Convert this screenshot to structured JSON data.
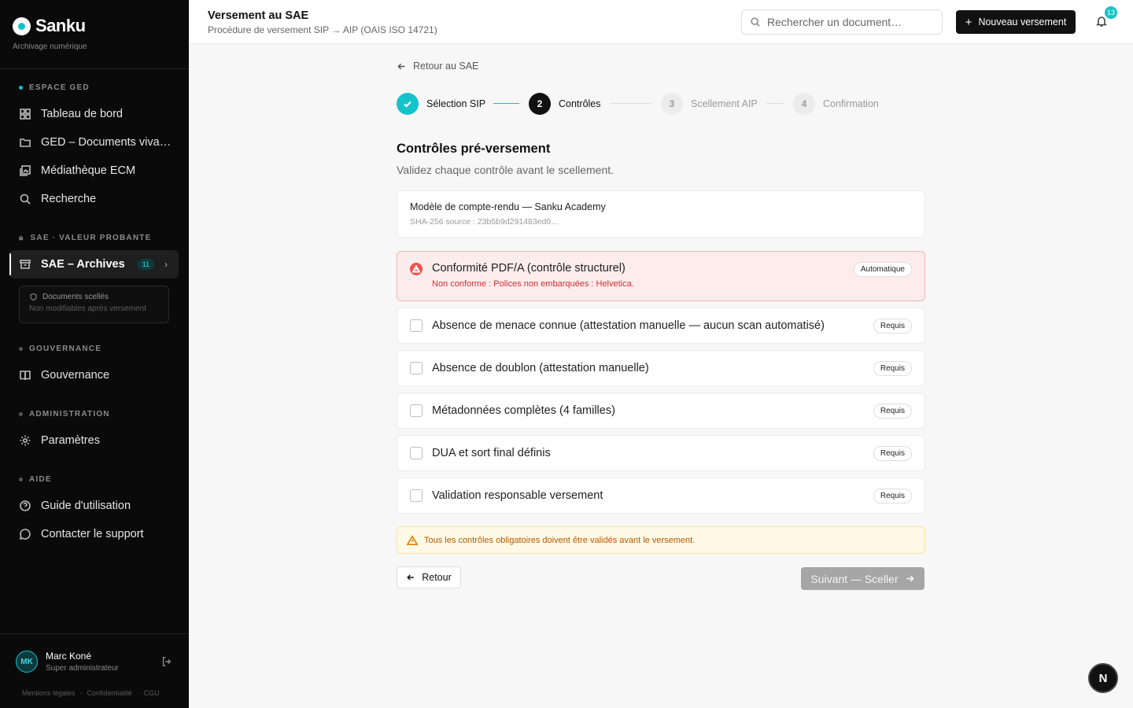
{
  "brand": {
    "name": "Sanku",
    "tagline": "Archivage numérique"
  },
  "sidebar": {
    "sections": [
      {
        "label": "ESPACE GED"
      },
      {
        "label": "SAE · VALEUR PROBANTE"
      },
      {
        "label": "GOUVERNANCE"
      },
      {
        "label": "ADMINISTRATION"
      },
      {
        "label": "AIDE"
      }
    ],
    "items": [
      {
        "label": "Tableau de bord",
        "icon": "dashboard-icon"
      },
      {
        "label": "GED – Documents viva…",
        "icon": "folder-icon"
      },
      {
        "label": "Médiathèque ECM",
        "icon": "media-icon"
      },
      {
        "label": "Recherche",
        "icon": "search-icon"
      },
      {
        "label": "SAE – Archives",
        "icon": "archive-icon",
        "badge": "11",
        "active": true
      },
      {
        "label": "Gouvernance",
        "icon": "book-icon"
      },
      {
        "label": "Paramètres",
        "icon": "gear-icon"
      },
      {
        "label": "Guide d'utilisation",
        "icon": "help-icon"
      },
      {
        "label": "Contacter le support",
        "icon": "chat-icon"
      }
    ],
    "sealed": {
      "title": "Documents scellés",
      "subtitle": "Non modifiables après versement"
    },
    "user": {
      "initials": "MK",
      "name": "Marc Koné",
      "role": "Super administrateur"
    },
    "footer": [
      "Mentions légales",
      "·",
      "Confidentialité",
      "·",
      "CGU"
    ]
  },
  "header": {
    "title": "Versement au SAE",
    "subtitle": "Procédure de versement SIP → AIP (OAIS ISO 14721)",
    "search_placeholder": "Rechercher un document…",
    "new_button": "Nouveau versement",
    "notifications": "13"
  },
  "main": {
    "back_link": "Retour au SAE",
    "steps": [
      {
        "label": "Sélection SIP",
        "number": "1",
        "state": "done"
      },
      {
        "label": "Contrôles",
        "number": "2",
        "state": "current"
      },
      {
        "label": "Scellement AIP",
        "number": "3",
        "state": "todo"
      },
      {
        "label": "Confirmation",
        "number": "4",
        "state": "todo"
      }
    ],
    "title": "Contrôles pré-versement",
    "subtitle": "Validez chaque contrôle avant le scellement.",
    "document": {
      "name": "Modèle de compte-rendu — Sanku Academy",
      "hash": "SHA-256 source : 23b5b9d291483ed0…"
    },
    "error_check": {
      "label": "Conformité PDF/A (contrôle structurel)",
      "message": "Non conforme : Polices non embarquées : Helvetica.",
      "tag": "Automatique"
    },
    "checks": [
      {
        "label": "Absence de menace connue (attestation manuelle — aucun scan automatisé)",
        "tag": "Requis",
        "checked": false
      },
      {
        "label": "Absence de doublon (attestation manuelle)",
        "tag": "Requis",
        "checked": false
      },
      {
        "label": "Métadonnées complètes (4 familles)",
        "tag": "Requis",
        "checked": false
      },
      {
        "label": "DUA et sort final définis",
        "tag": "Requis",
        "checked": false
      },
      {
        "label": "Validation responsable versement",
        "tag": "Requis",
        "checked": false
      }
    ],
    "warning": "Tous les contrôles obligatoires doivent être validés avant le versement.",
    "back_button": "Retour",
    "next_button": "Suivant — Sceller"
  },
  "fab": {
    "label": "N"
  },
  "colors": {
    "accent": "#14c3c9",
    "error": "#ef5350",
    "warning": "#d97a00",
    "sidebar_bg": "#0a0a0a"
  }
}
